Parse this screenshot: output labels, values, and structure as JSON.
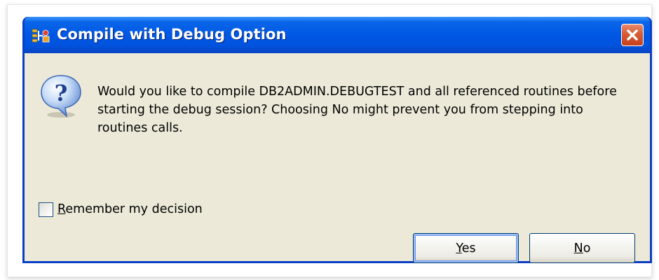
{
  "dialog": {
    "title": "Compile with Debug Option",
    "app_icon": "compile-debug-icon",
    "close_icon": "close-icon",
    "message": "Would you like to compile DB2ADMIN.DEBUGTEST and all referenced routines before starting the debug session? Choosing No might prevent you from stepping into routines calls.",
    "message_icon": "question-icon",
    "remember": {
      "mnemonic": "R",
      "rest": "emember my decision",
      "checked": false
    },
    "buttons": {
      "yes": {
        "mnemonic": "Y",
        "rest": "es",
        "default": true
      },
      "no": {
        "mnemonic": "N",
        "rest": "o",
        "default": false
      }
    }
  },
  "colors": {
    "titlebar": "#0054e3",
    "frame": "#0a3fc4",
    "client_area": "#ece9d8",
    "close_button": "#d65c36",
    "default_button_focus": "#6a97e8"
  }
}
